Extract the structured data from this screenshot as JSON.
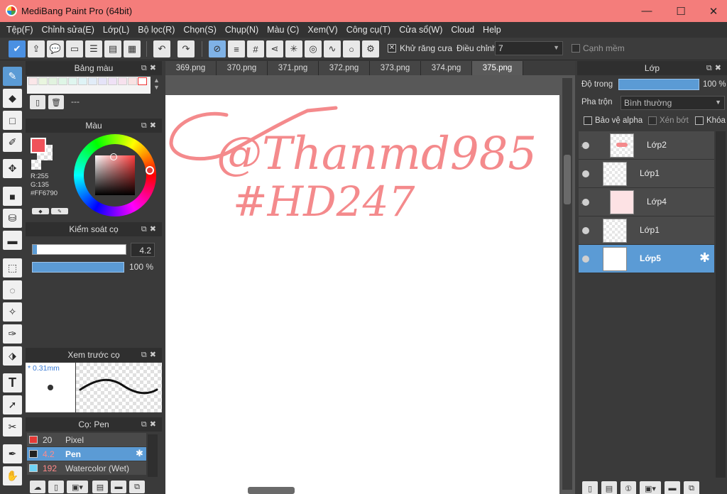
{
  "window": {
    "title": "MediBang Paint Pro (64bit)",
    "minimize": "—",
    "maximize": "☐",
    "close": "✕"
  },
  "menu": [
    "Tệp(F)",
    "Chỉnh sửa(E)",
    "Lớp(L)",
    "Bộ lọc(R)",
    "Chọn(S)",
    "Chụp(N)",
    "Màu (C)",
    "Xem(V)",
    "Công cụ(T)",
    "Cửa sổ(W)",
    "Cloud",
    "Help"
  ],
  "toolbar": {
    "antialias_label": "Khử răng cưa",
    "antialias_checked": "✕",
    "correction_label": "Điều chỉnh",
    "correction_value": "7",
    "soft_edge_label": "Cạnh mềm"
  },
  "palette_panel": {
    "title": "Bảng màu",
    "name": "---"
  },
  "color_panel": {
    "title": "Màu",
    "r": "R:255",
    "g": "G:135",
    "hex": "#FF6790",
    "fg_color": "#f0525a"
  },
  "brush_control": {
    "title": "Kiểm soát cọ",
    "size": "4.2",
    "opacity": "100 %"
  },
  "brush_preview": {
    "title": "Xem trước cọ",
    "size_label": "* 0.31mm"
  },
  "brush_list": {
    "title": "Cọ: Pen",
    "items": [
      {
        "size": "20",
        "name": "Pixel",
        "color": "#e53935"
      },
      {
        "size": "4.2",
        "name": "Pen",
        "color": "#222222"
      },
      {
        "size": "192",
        "name": "Watercolor (Wet)",
        "color": "#6fd3f5"
      }
    ]
  },
  "tabs": [
    "369.png",
    "370.png",
    "371.png",
    "372.png",
    "373.png",
    "374.png",
    "375.png"
  ],
  "canvas": {
    "line1": "@Thanmd985",
    "line2": "#HD247",
    "ink_color": "#f48a8c"
  },
  "layer_panel": {
    "title": "Lớp",
    "opacity_label": "Độ trong",
    "opacity_value": "100 %",
    "blend_label": "Pha trộn",
    "blend_value": "Bình thường",
    "protect_alpha": "Bảo vệ alpha",
    "clipping": "Xén bớt",
    "lock": "Khóa",
    "layers": [
      "Lớp2",
      "Lớp1",
      "Lớp4",
      "Lớp1",
      "Lớp5"
    ]
  }
}
